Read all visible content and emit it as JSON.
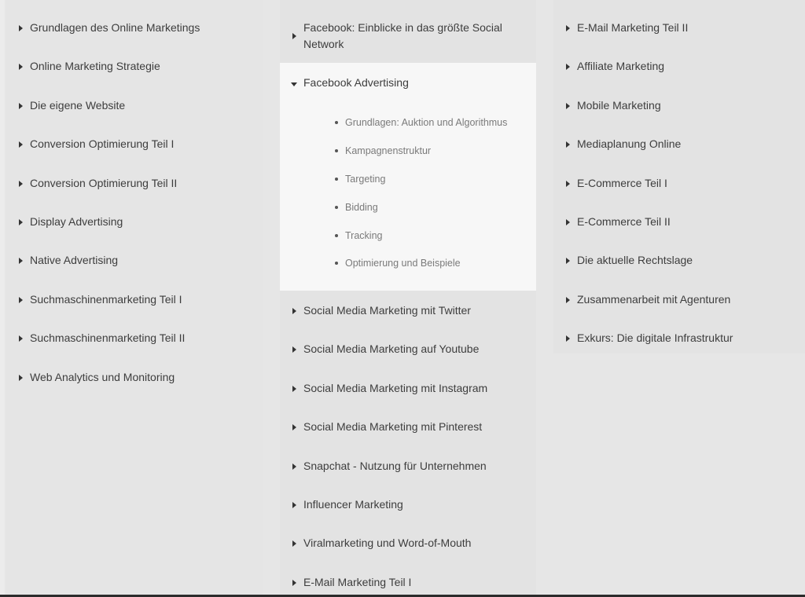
{
  "columns": [
    {
      "items": [
        {
          "label": "Grundlagen des Online Marketings",
          "icon": "caret-right-icon"
        },
        {
          "label": "Online Marketing Strategie",
          "icon": "caret-right-icon"
        },
        {
          "label": "Die eigene Website",
          "icon": "caret-right-icon"
        },
        {
          "label": "Conversion Optimierung Teil I",
          "icon": "caret-right-icon"
        },
        {
          "label": "Conversion Optimierung Teil II",
          "icon": "caret-right-icon"
        },
        {
          "label": "Display Advertising",
          "icon": "caret-right-icon"
        },
        {
          "label": "Native Advertising",
          "icon": "caret-right-icon"
        },
        {
          "label": "Suchmaschinenmarketing Teil I",
          "icon": "caret-right-icon"
        },
        {
          "label": "Suchmaschinenmarketing Teil II",
          "icon": "caret-right-icon"
        },
        {
          "label": "Web Analytics und Monitoring",
          "icon": "caret-right-icon"
        }
      ]
    },
    {
      "items": [
        {
          "label": "Facebook: Einblicke in das größte Social Network",
          "icon": "caret-right-icon"
        },
        {
          "label": "Facebook Advertising",
          "icon": "caret-down-icon",
          "expanded": true,
          "children": [
            "Grundlagen: Auktion und Algorithmus",
            "Kampagnenstruktur",
            "Targeting",
            "Bidding",
            "Tracking",
            "Optimierung und Beispiele"
          ]
        },
        {
          "label": "Social Media Marketing mit Twitter",
          "icon": "caret-right-icon"
        },
        {
          "label": "Social Media Marketing auf Youtube",
          "icon": "caret-right-icon"
        },
        {
          "label": "Social Media Marketing mit Instagram",
          "icon": "caret-right-icon"
        },
        {
          "label": "Social Media Marketing mit Pinterest",
          "icon": "caret-right-icon"
        },
        {
          "label": "Snapchat - Nutzung für Unternehmen",
          "icon": "caret-right-icon"
        },
        {
          "label": "Influencer Marketing",
          "icon": "caret-right-icon"
        },
        {
          "label": "Viralmarketing und Word-of-Mouth",
          "icon": "caret-right-icon"
        },
        {
          "label": "E-Mail Marketing Teil I",
          "icon": "caret-right-icon"
        }
      ]
    },
    {
      "items": [
        {
          "label": "E-Mail Marketing Teil II",
          "icon": "caret-right-icon"
        },
        {
          "label": "Affiliate Marketing",
          "icon": "caret-right-icon"
        },
        {
          "label": "Mobile Marketing",
          "icon": "caret-right-icon"
        },
        {
          "label": "Mediaplanung Online",
          "icon": "caret-right-icon"
        },
        {
          "label": "E-Commerce Teil I",
          "icon": "caret-right-icon"
        },
        {
          "label": "E-Commerce Teil II",
          "icon": "caret-right-icon"
        },
        {
          "label": "Die aktuelle Rechtslage",
          "icon": "caret-right-icon"
        },
        {
          "label": "Zusammenarbeit mit Agenturen",
          "icon": "caret-right-icon"
        },
        {
          "label": "Exkurs: Die digitale Infrastruktur",
          "icon": "caret-right-icon"
        }
      ]
    }
  ]
}
